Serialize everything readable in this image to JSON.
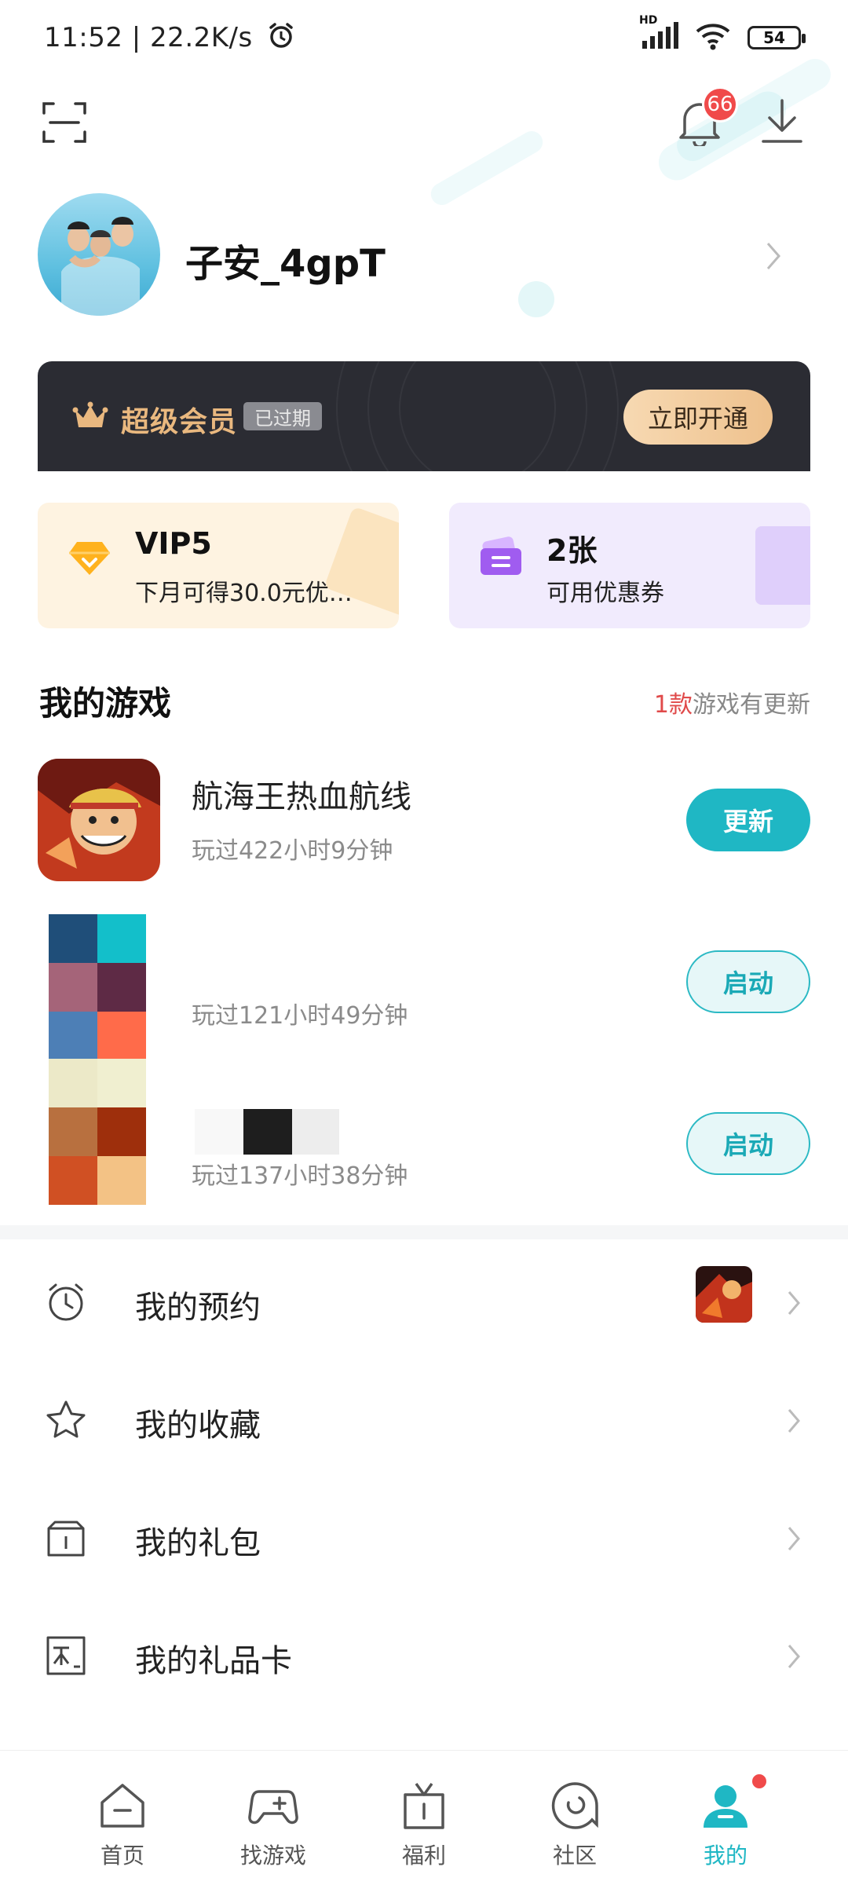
{
  "status_bar": {
    "time": "11:52 | 22.2K/s",
    "network_label": "HD",
    "battery": "54"
  },
  "header": {
    "notification_count": "66"
  },
  "profile": {
    "username": "子安_4gpT"
  },
  "vip_banner": {
    "title": "超级会员",
    "status": "已过期",
    "button": "立即开通"
  },
  "cards": {
    "vip": {
      "title": "VIP5",
      "subtitle": "下月可得30.0元优…"
    },
    "coupon": {
      "title": "2张",
      "subtitle": "可用优惠券"
    }
  },
  "my_games": {
    "title": "我的游戏",
    "update_count": "1款",
    "update_suffix": "游戏有更新",
    "games": [
      {
        "name": "航海王热血航线",
        "played": "玩过422小时9分钟",
        "button": "更新"
      },
      {
        "name": "",
        "played": "玩过121小时49分钟",
        "button": "启动"
      },
      {
        "name": "",
        "played": "玩过137小时38分钟",
        "button": "启动"
      }
    ]
  },
  "menu": [
    {
      "label": "我的预约"
    },
    {
      "label": "我的收藏"
    },
    {
      "label": "我的礼包"
    },
    {
      "label": "我的礼品卡"
    }
  ],
  "bottom_nav": [
    {
      "label": "首页"
    },
    {
      "label": "找游戏"
    },
    {
      "label": "福利"
    },
    {
      "label": "社区"
    },
    {
      "label": "我的"
    }
  ],
  "colors": {
    "accent": "#1fb7c4",
    "badge": "#f04a4a",
    "vip_gold": "#e9b87f"
  }
}
